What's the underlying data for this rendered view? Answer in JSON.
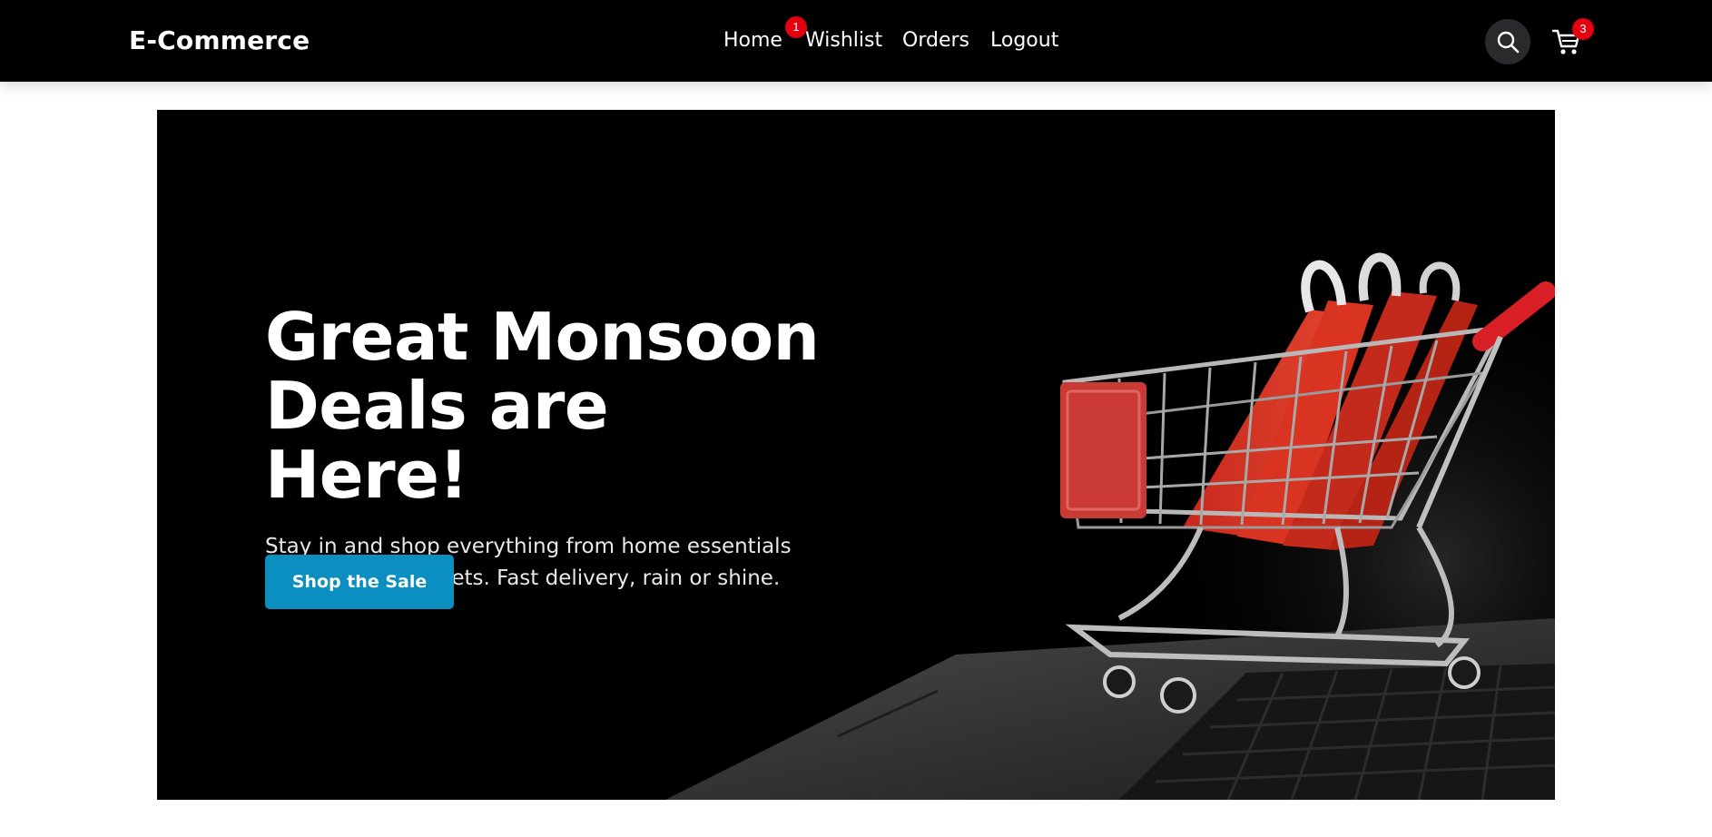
{
  "brand": {
    "name": "E-Commerce"
  },
  "nav": {
    "home": "Home",
    "wishlist": "Wishlist",
    "orders": "Orders",
    "logout": "Logout",
    "wishlist_count": "1"
  },
  "actions": {
    "search_icon": "search-icon",
    "cart_icon": "cart-icon",
    "cart_count": "3"
  },
  "hero": {
    "title_line1": "Great Monsoon",
    "title_line2": "Deals are Here!",
    "subtitle_line1": "Stay in and shop everything from home essentials",
    "subtitle_line2": "to the latest gadgets. Fast delivery, rain or shine.",
    "cta_label": "Shop the Sale",
    "image_subject": "shopping-cart-with-red-bags-on-laptop"
  },
  "colors": {
    "navbar_bg": "#000000",
    "badge": "#e3000f",
    "cta": "#0a8fc0",
    "hero_bg": "#000000"
  }
}
